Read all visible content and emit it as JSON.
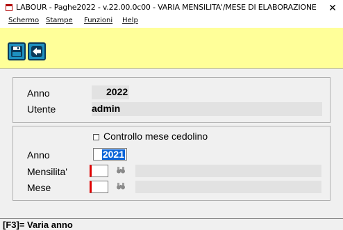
{
  "window": {
    "title": "LABOUR - Paghe2022 - v.22.00.0c00 - VARIA MENSILITA'/MESE DI ELABORAZIONE",
    "close_glyph": "✕"
  },
  "menu": {
    "items": [
      {
        "label": "Schermo"
      },
      {
        "label": "Stampe"
      },
      {
        "label": "Funzioni"
      },
      {
        "label": "Help"
      }
    ]
  },
  "toolbar": {
    "buttons": [
      {
        "icon": "save-icon"
      },
      {
        "icon": "back-arrow-icon"
      }
    ],
    "button_color": "#1e90c0",
    "background": "#ffff99"
  },
  "info_panel": {
    "anno_label": "Anno",
    "anno_value": "2022",
    "utente_label": "Utente",
    "utente_value": "admin"
  },
  "form_panel": {
    "checkbox_label": "Controllo mese cedolino",
    "checkbox_checked": false,
    "anno_label": "Anno",
    "anno_value": "2021",
    "mensilita_label": "Mensilita'",
    "mensilita_value": "",
    "mese_label": "Mese",
    "mese_value": "",
    "lookup_icon": "binoculars-icon",
    "required_color": "#e00000"
  },
  "status": {
    "text": "[F3]= Varia anno"
  }
}
